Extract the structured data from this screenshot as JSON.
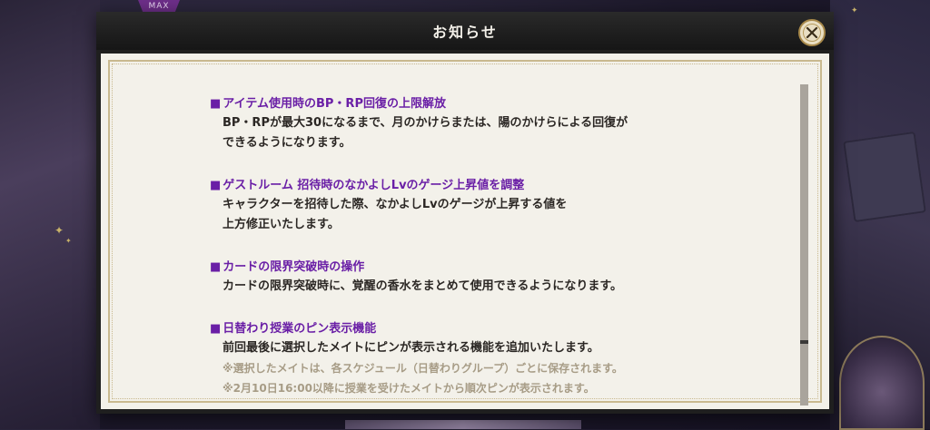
{
  "background": {
    "max_badge": "MAX"
  },
  "dialog": {
    "title": "お知らせ",
    "close_icon": "close-icon",
    "sections": [
      {
        "title": "アイテム使用時のBP・RP回復の上限解放",
        "body": [
          "BP・RPが最大30になるまで、月のかけらまたは、陽のかけらによる回復が",
          "できるようになります。"
        ],
        "notes": []
      },
      {
        "title": "ゲストルーム 招待時のなかよしLvのゲージ上昇値を調整",
        "body": [
          "キャラクターを招待した際、なかよしLvのゲージが上昇する値を",
          "上方修正いたします。"
        ],
        "notes": []
      },
      {
        "title": "カードの限界突破時の操作",
        "body": [
          "カードの限界突破時に、覚醒の香水をまとめて使用できるようになります。"
        ],
        "notes": []
      },
      {
        "title": "日替わり授業のピン表示機能",
        "body": [
          "前回最後に選択したメイトにピンが表示される機能を追加いたします。"
        ],
        "notes": [
          "※選択したメイトは、各スケジュール（日替わりグループ）ごとに保存されます。",
          "※2月10日16:00以降に授業を受けたメイトから順次ピンが表示されます。"
        ]
      }
    ],
    "section_marker": "■"
  },
  "colors": {
    "section_title": "#6a1fa6",
    "body_text": "#2b2724",
    "note_text": "#a79c86",
    "paper": "#f3f1ea",
    "frame_gold": "#c9b98f"
  }
}
